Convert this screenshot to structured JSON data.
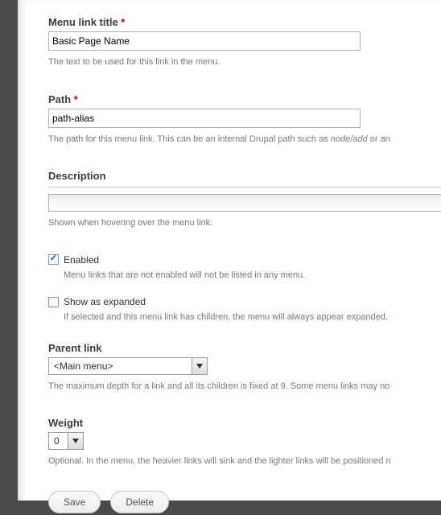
{
  "fields": {
    "menu_link_title": {
      "label": "Menu link title",
      "required_marker": "*",
      "value": "Basic Page Name",
      "help": "The text to be used for this link in the menu."
    },
    "path": {
      "label": "Path",
      "required_marker": "*",
      "value": "path-alias",
      "help_pre": "The path for this menu link. This can be an internal Drupal path such as ",
      "help_em": "node/add",
      "help_post": " or an"
    },
    "description": {
      "label": "Description",
      "help": "Shown when hovering over the menu link."
    },
    "enabled": {
      "label": "Enabled",
      "checked": true,
      "help": "Menu links that are not enabled will not be listed in any menu."
    },
    "expanded": {
      "label": "Show as expanded",
      "checked": false,
      "help": "If selected and this menu link has children, the menu will always appear expanded."
    },
    "parent_link": {
      "label": "Parent link",
      "value": "<Main menu>",
      "help": "The maximum depth for a link and all its children is fixed at 9. Some menu links may no"
    },
    "weight": {
      "label": "Weight",
      "value": "0",
      "help": "Optional. In the menu, the heavier links will sink and the lighter links will be positioned n"
    }
  },
  "buttons": {
    "save": "Save",
    "delete": "Delete"
  }
}
